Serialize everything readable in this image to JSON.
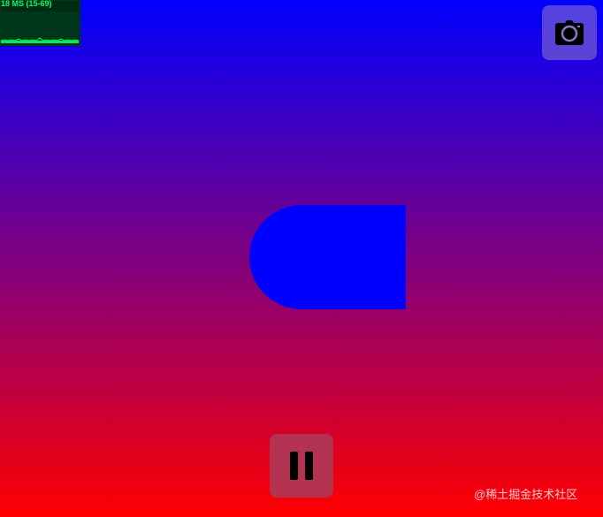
{
  "perf_monitor": {
    "text": "18 MS (15-69)",
    "color": "#00ff66"
  },
  "toolbar": {
    "screenshot_icon": "camera-icon",
    "pause_icon": "pause-icon"
  },
  "scene": {
    "gradient_top": "#0000ff",
    "gradient_bottom": "#ff0000",
    "shape_color": "#0000ff"
  },
  "watermark": {
    "text": "@稀土掘金技术社区"
  }
}
